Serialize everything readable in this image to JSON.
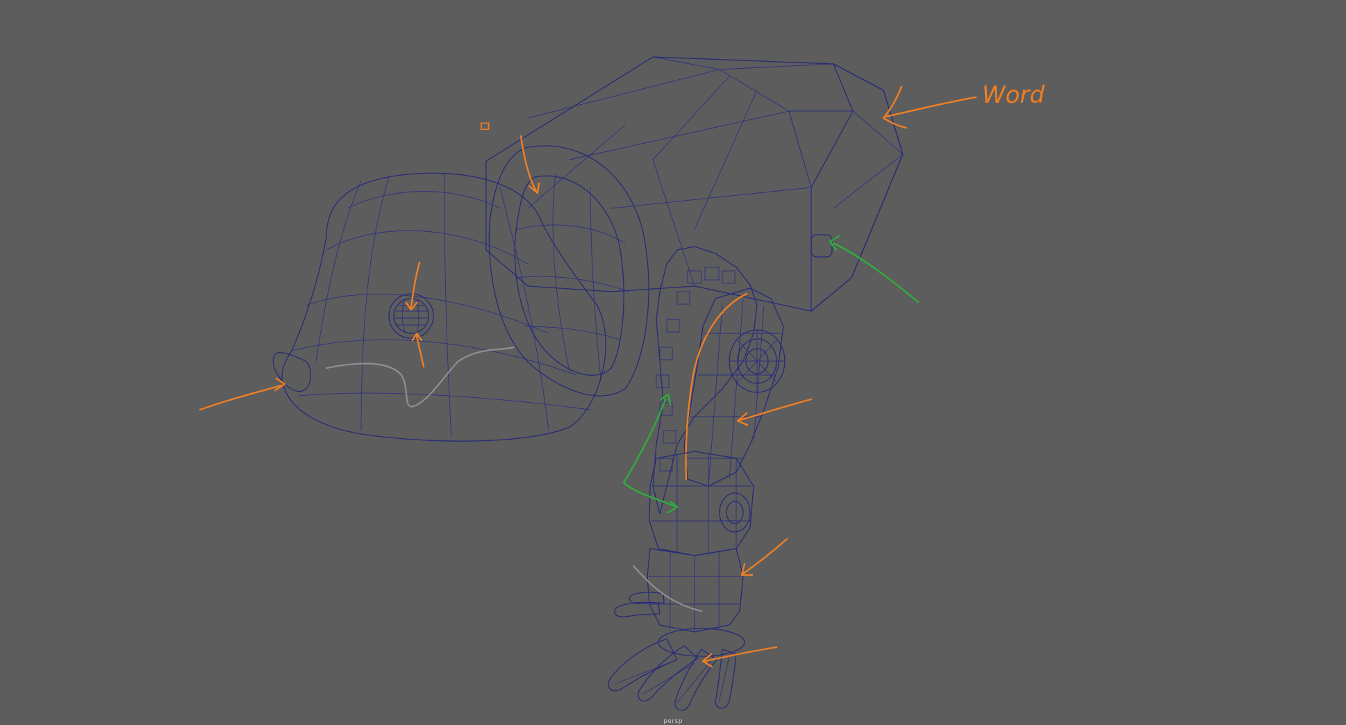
{
  "viewport": {
    "camera_label": "persp",
    "background_color": "#5d5d5d"
  },
  "model": {
    "surface_color": "#8a8a8a",
    "wireframe_color": "#262a78"
  },
  "annotations": {
    "ink_colors": {
      "orange": "#ee7f25",
      "green": "#2fae3b",
      "gray": "#8f8f8f"
    },
    "notes": [
      {
        "id": "note-top",
        "text": "ㅁ"
      },
      {
        "id": "note-right",
        "text": "Word"
      }
    ]
  }
}
